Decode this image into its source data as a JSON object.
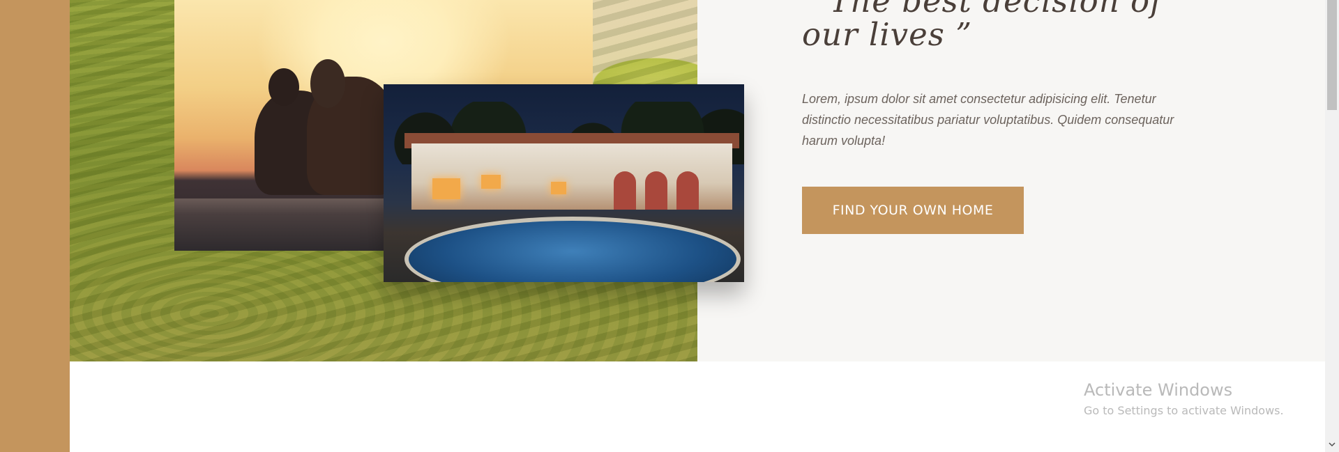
{
  "testimonial": {
    "quote": "“ The best decision of our lives ”",
    "body": "Lorem, ipsum dolor sit amet consectetur adipisicing elit. Tenetur distinctio necessitatibus pariatur voluptatibus. Quidem consequatur harum volupta!",
    "cta_label": "FIND YOUR OWN HOME"
  },
  "images": {
    "couple": "couple-sunset-photo",
    "villa": "villa-pool-photo"
  },
  "watermark": {
    "title": "Activate Windows",
    "subtitle": "Go to Settings to activate Windows."
  },
  "scrollbar": {
    "down_arrow": "⌵"
  },
  "colors": {
    "accent": "#c4955d",
    "panel": "#f7f6f4",
    "heading": "#4a3f39",
    "text": "#6c635d"
  }
}
